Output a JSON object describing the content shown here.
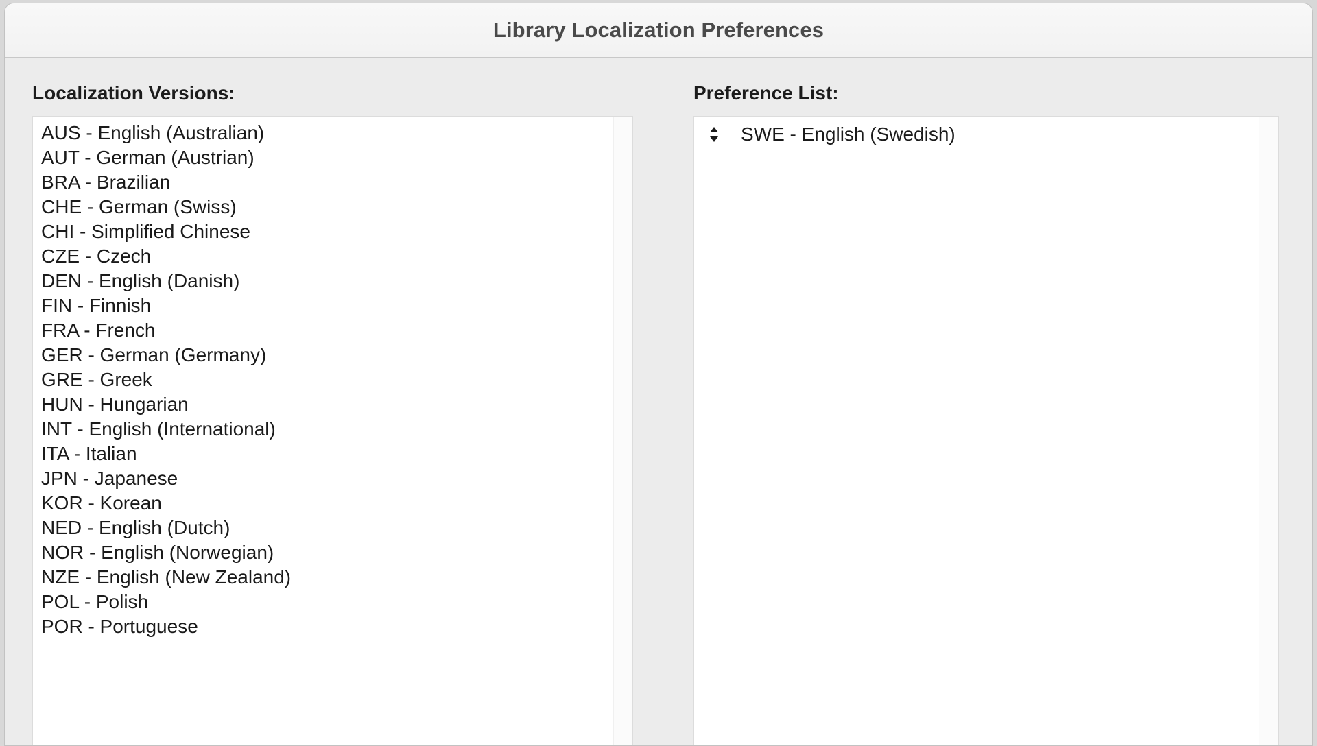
{
  "window": {
    "title": "Library Localization Preferences"
  },
  "left_pane": {
    "label": "Localization Versions:",
    "items": [
      "AUS - English (Australian)",
      "AUT - German (Austrian)",
      "BRA - Brazilian",
      "CHE - German (Swiss)",
      "CHI - Simplified Chinese",
      "CZE - Czech",
      "DEN - English (Danish)",
      "FIN - Finnish",
      "FRA - French",
      "GER - German (Germany)",
      "GRE - Greek",
      "HUN - Hungarian",
      "INT - English (International)",
      "ITA - Italian",
      "JPN - Japanese",
      "KOR - Korean",
      "NED - English (Dutch)",
      "NOR - English (Norwegian)",
      "NZE - English (New Zealand)",
      "POL - Polish",
      "POR - Portuguese"
    ]
  },
  "right_pane": {
    "label": "Preference List:",
    "items": [
      {
        "text": "SWE - English (Swedish)",
        "handle_icon": "drag-reorder-icon"
      }
    ]
  },
  "colors": {
    "window_background": "#ececec",
    "titlebar_background": "#f6f6f6",
    "list_background": "#ffffff",
    "scrolltrack_background": "#fbfbfb",
    "text": "#1a1a1a",
    "title_text": "#4a4a4a",
    "border": "#dcdcdc"
  }
}
